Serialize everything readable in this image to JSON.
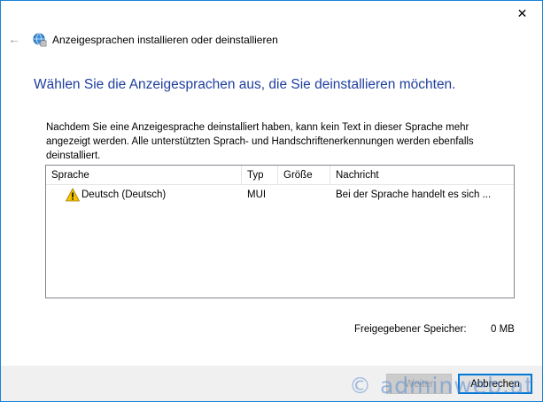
{
  "window": {
    "title": "Anzeigesprachen installieren oder deinstallieren",
    "back_icon": "←",
    "close_icon": "✕"
  },
  "main": {
    "heading": "Wählen Sie die Anzeigesprachen aus, die Sie deinstallieren möchten.",
    "description": "Nachdem Sie eine Anzeigesprache deinstalliert haben, kann kein Text in dieser Sprache mehr angezeigt werden. Alle unterstützten Sprach- und Handschriftenerkennungen werden ebenfalls deinstalliert."
  },
  "list": {
    "columns": [
      "Sprache",
      "Typ",
      "Größe",
      "Nachricht"
    ],
    "rows": [
      {
        "icon": "warning-icon",
        "name": "Deutsch (Deutsch)",
        "type": "MUI",
        "size": "",
        "message": "Bei der Sprache handelt es sich ..."
      }
    ]
  },
  "space": {
    "label": "Freigegebener Speicher:",
    "value": "0 MB"
  },
  "footer": {
    "next_label": "Weiter",
    "cancel_label": "Abbrechen"
  },
  "watermark": "© adminweb.at",
  "colors": {
    "accent": "#1883d7",
    "heading": "#1e3f9e",
    "footer_bg": "#f0f0f0"
  }
}
